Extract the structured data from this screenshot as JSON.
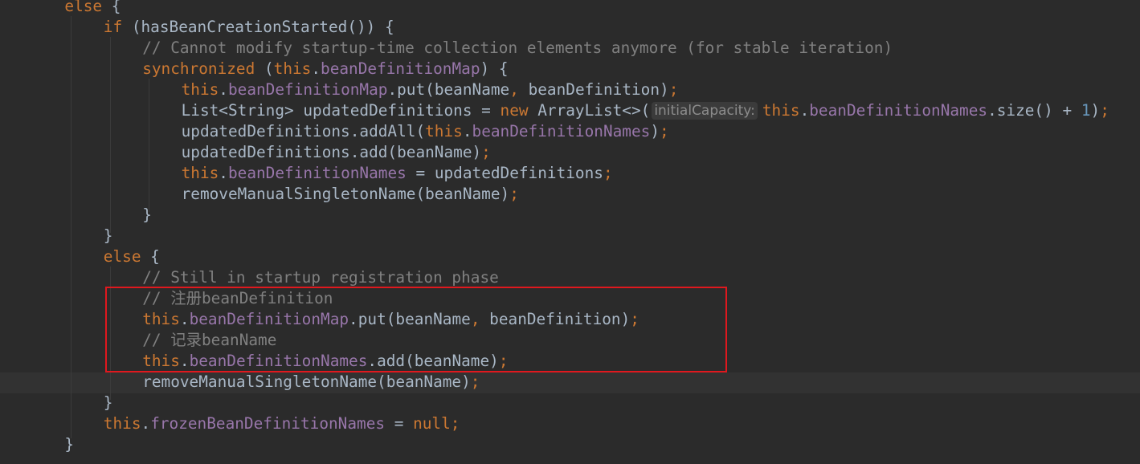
{
  "code_lines": [
    {
      "indent": 1,
      "segments": [
        {
          "t": "else ",
          "c": "kw"
        },
        {
          "t": "{",
          "c": ""
        }
      ]
    },
    {
      "indent": 2,
      "segments": [
        {
          "t": "if ",
          "c": "kw"
        },
        {
          "t": "(hasBeanCreationStarted()) {",
          "c": ""
        }
      ]
    },
    {
      "indent": 3,
      "segments": [
        {
          "t": "// Cannot modify startup-time collection elements anymore (for stable iteration)",
          "c": "cmt"
        }
      ]
    },
    {
      "indent": 3,
      "segments": [
        {
          "t": "synchronized ",
          "c": "kw"
        },
        {
          "t": "(",
          "c": ""
        },
        {
          "t": "this",
          "c": "kw"
        },
        {
          "t": ".",
          "c": ""
        },
        {
          "t": "beanDefinitionMap",
          "c": "fld"
        },
        {
          "t": ") {",
          "c": ""
        }
      ]
    },
    {
      "indent": 4,
      "segments": [
        {
          "t": "this",
          "c": "kw"
        },
        {
          "t": ".",
          "c": ""
        },
        {
          "t": "beanDefinitionMap",
          "c": "fld"
        },
        {
          "t": ".put(beanName",
          "c": ""
        },
        {
          "t": ", ",
          "c": "kw"
        },
        {
          "t": "beanDefinition)",
          "c": ""
        },
        {
          "t": ";",
          "c": "kw"
        }
      ]
    },
    {
      "indent": 4,
      "segments": [
        {
          "t": "List<String> updatedDefinitions = ",
          "c": ""
        },
        {
          "t": "new ",
          "c": "kw"
        },
        {
          "t": "ArrayList<>(",
          "c": ""
        },
        {
          "t": "initialCapacity:",
          "c": "hint"
        },
        {
          "t": "this",
          "c": "kw"
        },
        {
          "t": ".",
          "c": ""
        },
        {
          "t": "beanDefinitionNames",
          "c": "fld"
        },
        {
          "t": ".size() + ",
          "c": ""
        },
        {
          "t": "1",
          "c": "num"
        },
        {
          "t": ")",
          "c": ""
        },
        {
          "t": ";",
          "c": "kw"
        }
      ]
    },
    {
      "indent": 4,
      "segments": [
        {
          "t": "updatedDefinitions.addAll(",
          "c": ""
        },
        {
          "t": "this",
          "c": "kw"
        },
        {
          "t": ".",
          "c": ""
        },
        {
          "t": "beanDefinitionNames",
          "c": "fld"
        },
        {
          "t": ")",
          "c": ""
        },
        {
          "t": ";",
          "c": "kw"
        }
      ]
    },
    {
      "indent": 4,
      "segments": [
        {
          "t": "updatedDefinitions.add(beanName)",
          "c": ""
        },
        {
          "t": ";",
          "c": "kw"
        }
      ]
    },
    {
      "indent": 4,
      "segments": [
        {
          "t": "this",
          "c": "kw"
        },
        {
          "t": ".",
          "c": ""
        },
        {
          "t": "beanDefinitionNames",
          "c": "fld"
        },
        {
          "t": " = updatedDefinitions",
          "c": ""
        },
        {
          "t": ";",
          "c": "kw"
        }
      ]
    },
    {
      "indent": 4,
      "segments": [
        {
          "t": "removeManualSingletonName(beanName)",
          "c": ""
        },
        {
          "t": ";",
          "c": "kw"
        }
      ]
    },
    {
      "indent": 3,
      "segments": [
        {
          "t": "}",
          "c": ""
        }
      ]
    },
    {
      "indent": 2,
      "segments": [
        {
          "t": "}",
          "c": ""
        }
      ]
    },
    {
      "indent": 2,
      "segments": [
        {
          "t": "else ",
          "c": "kw"
        },
        {
          "t": "{",
          "c": ""
        }
      ]
    },
    {
      "indent": 3,
      "segments": [
        {
          "t": "// Still in startup registration phase",
          "c": "cmt"
        }
      ]
    },
    {
      "indent": 3,
      "segments": [
        {
          "t": "// 注册beanDefinition",
          "c": "cmt"
        }
      ]
    },
    {
      "indent": 3,
      "segments": [
        {
          "t": "this",
          "c": "kw"
        },
        {
          "t": ".",
          "c": ""
        },
        {
          "t": "beanDefinitionMap",
          "c": "fld"
        },
        {
          "t": ".put(beanName",
          "c": ""
        },
        {
          "t": ", ",
          "c": "kw"
        },
        {
          "t": "beanDefinition)",
          "c": ""
        },
        {
          "t": ";",
          "c": "kw"
        }
      ]
    },
    {
      "indent": 3,
      "segments": [
        {
          "t": "// 记录beanName",
          "c": "cmt"
        }
      ]
    },
    {
      "indent": 3,
      "segments": [
        {
          "t": "this",
          "c": "kw"
        },
        {
          "t": ".",
          "c": ""
        },
        {
          "t": "beanDefinitionNames",
          "c": "fld"
        },
        {
          "t": ".add(beanName)",
          "c": ""
        },
        {
          "t": ";",
          "c": "kw"
        }
      ]
    },
    {
      "indent": 3,
      "segments": [
        {
          "t": "removeManualSingletonName(beanName)",
          "c": ""
        },
        {
          "t": ";",
          "c": "kw"
        }
      ]
    },
    {
      "indent": 2,
      "segments": [
        {
          "t": "}",
          "c": ""
        }
      ]
    },
    {
      "indent": 2,
      "segments": [
        {
          "t": "this",
          "c": "kw"
        },
        {
          "t": ".",
          "c": ""
        },
        {
          "t": "frozenBeanDefinitionNames",
          "c": "fld"
        },
        {
          "t": " = ",
          "c": ""
        },
        {
          "t": "null",
          "c": "kw"
        },
        {
          "t": ";",
          "c": "kw"
        }
      ]
    },
    {
      "indent": 1,
      "segments": [
        {
          "t": "}",
          "c": ""
        }
      ]
    }
  ],
  "colors": {
    "background": "#2b2b2b",
    "keyword": "#cc7832",
    "field": "#9876aa",
    "comment": "#808080",
    "number": "#6897bb",
    "text": "#a9b7c6",
    "highlight_box": "#e0181e"
  }
}
